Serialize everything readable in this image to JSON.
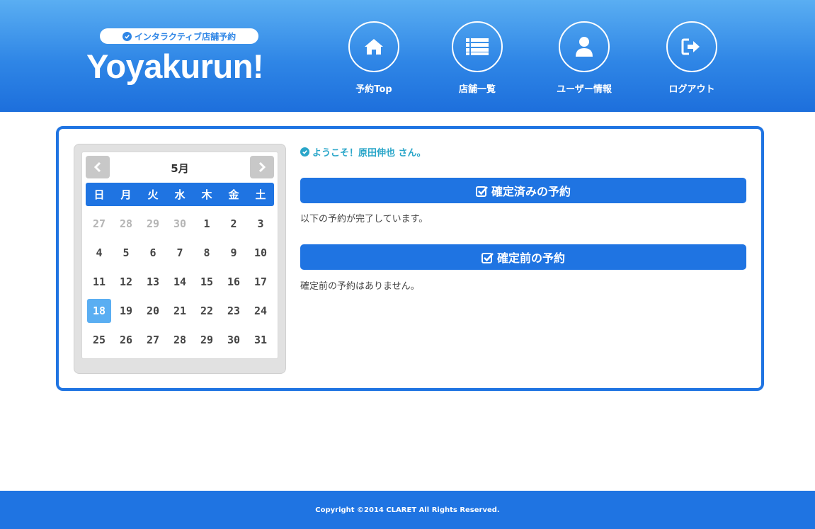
{
  "header": {
    "tagline": "インタラクティブ店舗予約",
    "logo": "Yoyakurun!",
    "nav": [
      {
        "label": "予約Top",
        "icon": "home-icon"
      },
      {
        "label": "店舗一覧",
        "icon": "list-icon"
      },
      {
        "label": "ユーザー情報",
        "icon": "user-icon"
      },
      {
        "label": "ログアウト",
        "icon": "logout-icon"
      }
    ]
  },
  "calendar": {
    "month": "5月",
    "weekdays": [
      "日",
      "月",
      "火",
      "水",
      "木",
      "金",
      "土"
    ],
    "days": [
      {
        "d": "27",
        "muted": true
      },
      {
        "d": "28",
        "muted": true
      },
      {
        "d": "29",
        "muted": true
      },
      {
        "d": "30",
        "muted": true
      },
      {
        "d": "1"
      },
      {
        "d": "2"
      },
      {
        "d": "3"
      },
      {
        "d": "4"
      },
      {
        "d": "5"
      },
      {
        "d": "6"
      },
      {
        "d": "7"
      },
      {
        "d": "8"
      },
      {
        "d": "9"
      },
      {
        "d": "10"
      },
      {
        "d": "11"
      },
      {
        "d": "12"
      },
      {
        "d": "13"
      },
      {
        "d": "14"
      },
      {
        "d": "15"
      },
      {
        "d": "16"
      },
      {
        "d": "17"
      },
      {
        "d": "18",
        "today": true
      },
      {
        "d": "19"
      },
      {
        "d": "20"
      },
      {
        "d": "21"
      },
      {
        "d": "22"
      },
      {
        "d": "23"
      },
      {
        "d": "24"
      },
      {
        "d": "25"
      },
      {
        "d": "26"
      },
      {
        "d": "27"
      },
      {
        "d": "28"
      },
      {
        "d": "29"
      },
      {
        "d": "30"
      },
      {
        "d": "31"
      }
    ]
  },
  "main": {
    "welcome": "ようこそ！原田伸也 さん。",
    "confirmed_title": "確定済みの予約",
    "confirmed_text": "以下の予約が完了しています。",
    "pending_title": "確定前の予約",
    "pending_text": "確定前の予約はありません。"
  },
  "footer": {
    "copyright": "Copyright ©2014 CLARET All Rights Reserved."
  },
  "colors": {
    "primary": "#1f74e2",
    "header_top": "#5aaef2",
    "today": "#5aaef2",
    "welcome": "#2aa6c9"
  }
}
